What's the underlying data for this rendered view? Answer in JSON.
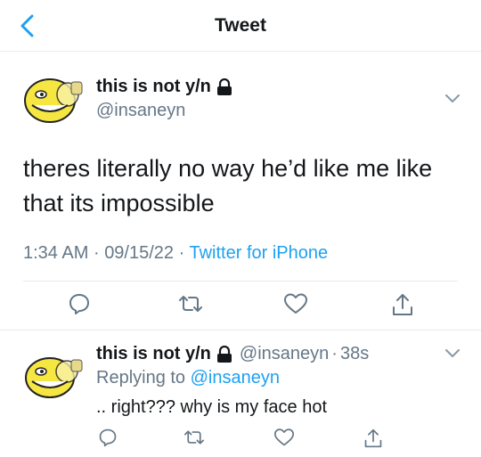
{
  "header": {
    "title": "Tweet"
  },
  "tweet": {
    "display_name": "this is not y/n",
    "handle": "@insaneyn",
    "text": "theres literally no way he’d like me like that its impossible",
    "time": "1:34 AM",
    "dot1": "·",
    "date": "09/15/22",
    "dot2": "·",
    "source": "Twitter for iPhone"
  },
  "reply": {
    "display_name": "this is not y/n",
    "handle": "@insaneyn",
    "dot": "·",
    "age": "38s",
    "replying_prefix": "Replying to",
    "replying_to": "@insaneyn",
    "text": ".. right??? why is my face hot"
  },
  "colors": {
    "accent": "#1da1f2",
    "muted": "#657786",
    "divider": "#e6ecf0",
    "avatar": "#f5e642"
  }
}
